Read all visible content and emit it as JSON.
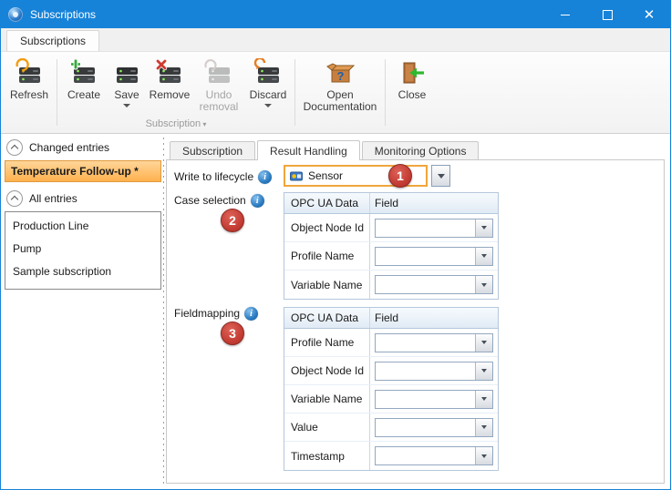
{
  "window": {
    "title": "Subscriptions"
  },
  "colors": {
    "titlebar_blue": "#1683d9",
    "selection_orange": "#ffb14e",
    "highlight_border_orange": "#f0a63c",
    "badge_red": "#c23b32",
    "info_blue": "#2a7ac0",
    "table_header_blue": "#e1ebf5"
  },
  "ribbon": {
    "tab_label": "Subscriptions",
    "groups": [
      {
        "label": "",
        "buttons": [
          {
            "label": "Refresh"
          }
        ]
      },
      {
        "label": "Subscription",
        "buttons": [
          {
            "label": "Create"
          },
          {
            "label": "Save",
            "dropdown": true
          },
          {
            "label": "Remove"
          },
          {
            "label": "Undo removal",
            "disabled": true
          },
          {
            "label": "Discard",
            "dropdown": true
          }
        ]
      },
      {
        "label": "",
        "buttons": [
          {
            "label": "Open Documentation"
          }
        ]
      },
      {
        "label": "",
        "buttons": [
          {
            "label": "Close"
          }
        ]
      }
    ]
  },
  "sidebar": {
    "changed_header": "Changed entries",
    "changed_item": "Temperature Follow-up *",
    "all_header": "All entries",
    "all_items": [
      "Production Line",
      "Pump",
      "Sample subscription"
    ]
  },
  "main": {
    "tabs": [
      {
        "label": "Subscription"
      },
      {
        "label": "Result Handling",
        "active": true
      },
      {
        "label": "Monitoring Options"
      }
    ],
    "lifecycle": {
      "label": "Write to lifecycle",
      "value": "Sensor",
      "badge": "1"
    },
    "case_selection": {
      "label": "Case selection",
      "badge": "2",
      "col1": "OPC UA Data",
      "col2": "Field",
      "rows": [
        "Object Node Id",
        "Profile Name",
        "Variable Name"
      ]
    },
    "fieldmapping": {
      "label": "Fieldmapping",
      "badge": "3",
      "col1": "OPC UA Data",
      "col2": "Field",
      "rows": [
        "Profile Name",
        "Object Node Id",
        "Variable Name",
        "Value",
        "Timestamp"
      ]
    }
  }
}
